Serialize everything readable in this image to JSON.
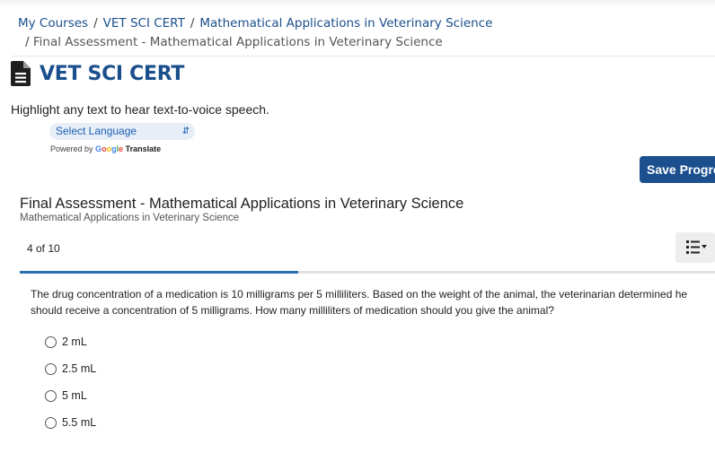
{
  "breadcrumb": {
    "items": [
      "My Courses",
      "VET SCI CERT",
      "Mathematical Applications in Veterinary Science"
    ],
    "separator": "/",
    "current": "Final Assessment - Mathematical Applications in Veterinary Science"
  },
  "page": {
    "title": "VET SCI CERT",
    "icon": "document-icon",
    "tts_hint": "Highlight any text to hear text-to-voice speech."
  },
  "translate": {
    "select_label": "Select Language",
    "powered_by": "Powered by",
    "google": "Google",
    "translate_word": "Translate"
  },
  "toolbar": {
    "save_label": "Save Progress"
  },
  "assessment": {
    "title": "Final Assessment - Mathematical Applications in Veterinary Science",
    "subtitle": "Mathematical Applications in Veterinary Science",
    "counter": "4 of 10",
    "progress_fraction": 0.4
  },
  "question": {
    "text": "The drug concentration of a medication is 10 milligrams per 5 milliliters. Based on the weight of the animal, the veterinarian determined he should receive a concentration of 5 milligrams. How many milliliters of medication should you give the animal?",
    "options": [
      "2 mL",
      "2.5 mL",
      "5 mL",
      "5.5 mL"
    ]
  },
  "colors": {
    "accent": "#1a4f8c",
    "button": "#1b4f8e",
    "progress": "#2a6fb0"
  }
}
